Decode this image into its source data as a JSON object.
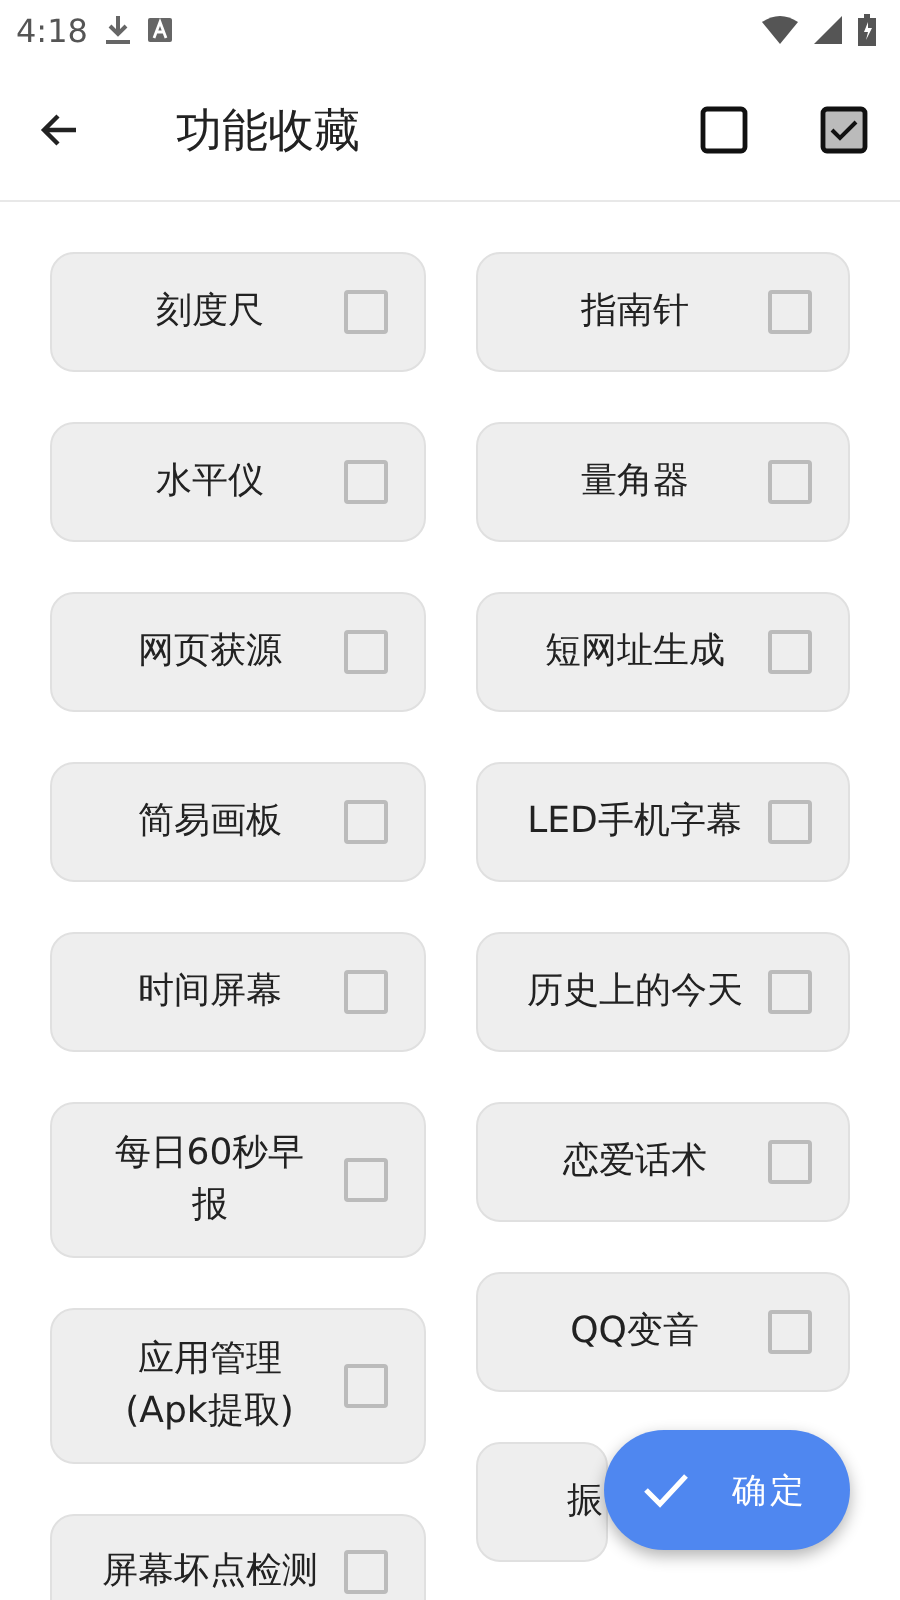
{
  "status_bar": {
    "time": "4:18"
  },
  "toolbar": {
    "title": "功能收藏",
    "actions": [
      {
        "checked": false
      },
      {
        "checked": true
      }
    ]
  },
  "columns": [
    [
      {
        "label": "刻度尺",
        "checked": false
      },
      {
        "label": "水平仪",
        "checked": false
      },
      {
        "label": "网页获源",
        "checked": false
      },
      {
        "label": "简易画板",
        "checked": false
      },
      {
        "label": "时间屏幕",
        "checked": false
      },
      {
        "label": "每日60秒早报",
        "checked": false
      },
      {
        "label": "应用管理(Apk提取)",
        "checked": false
      },
      {
        "label": "屏幕坏点检测",
        "checked": false
      }
    ],
    [
      {
        "label": "指南针",
        "checked": false
      },
      {
        "label": "量角器",
        "checked": false
      },
      {
        "label": "短网址生成",
        "checked": false
      },
      {
        "label": "LED手机字幕",
        "checked": false
      },
      {
        "label": "历史上的今天",
        "checked": false
      },
      {
        "label": "恋爱话术",
        "checked": false
      },
      {
        "label": "QQ变音",
        "checked": false
      },
      {
        "label": "振",
        "covered": true
      }
    ]
  ],
  "fab": {
    "label": "确定"
  }
}
